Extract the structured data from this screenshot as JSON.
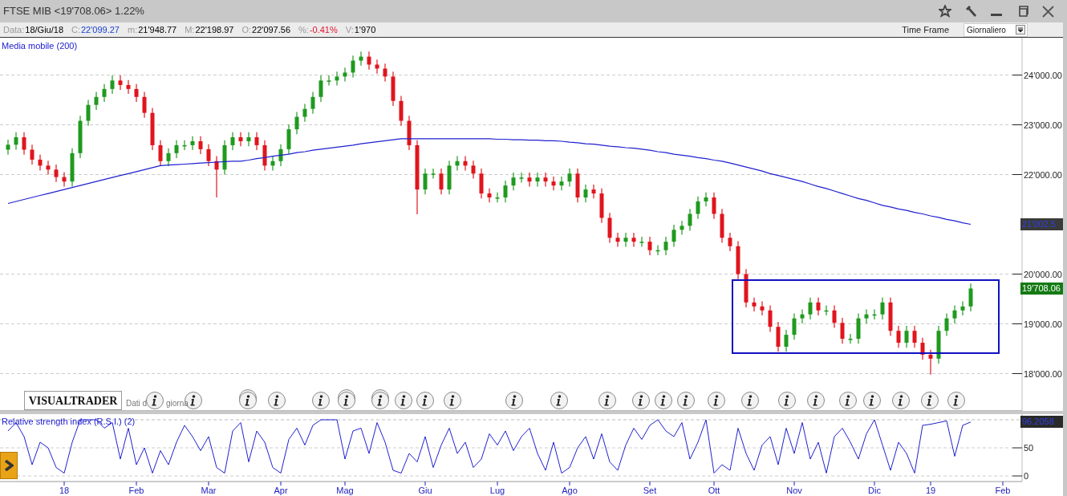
{
  "window": {
    "title": "FTSE MIB <19'708.06> 1.22%"
  },
  "info_bar": [
    {
      "label": "Data:",
      "value": "18/Giu/18"
    },
    {
      "label": "C:",
      "value": "22'099.27",
      "color": "#1a3fd0"
    },
    {
      "label": "m:",
      "value": "21'948.77"
    },
    {
      "label": "M:",
      "value": "22'198.97"
    },
    {
      "label": "O:",
      "value": "22'097.56"
    },
    {
      "label": "%:",
      "value": "-0.41%",
      "color": "#e0152d"
    },
    {
      "label": "V:",
      "value": "1'970"
    }
  ],
  "time_frame": {
    "label": "Time Frame",
    "value": "Giornaliero"
  },
  "price_panel": {
    "logo": "VISUALTRADER",
    "source_note": [
      "Dati d",
      "giorna"
    ],
    "last_values": [
      {
        "text": "21'002.5",
        "kind": "average"
      },
      {
        "text": "19'708.06",
        "kind": "price"
      }
    ],
    "events": [
      {
        "double": false
      },
      {
        "double": false
      },
      {
        "double": true
      },
      {
        "double": false
      },
      {
        "double": false
      },
      {
        "double": true
      },
      {
        "double": true
      },
      {
        "double": false
      },
      {
        "double": false
      },
      {
        "double": false
      },
      {
        "double": false
      },
      {
        "double": false
      },
      {
        "double": false
      },
      {
        "double": false
      },
      {
        "double": false
      },
      {
        "double": false
      },
      {
        "double": false
      },
      {
        "double": false
      },
      {
        "double": false
      },
      {
        "double": false
      },
      {
        "double": false
      },
      {
        "double": false
      },
      {
        "double": false
      },
      {
        "double": false
      },
      {
        "double": false
      }
    ],
    "chart_data": {
      "type": "candlestick",
      "grid": true,
      "ylim": [
        17250,
        24750
      ],
      "categories": [
        null,
        null,
        null,
        null,
        null,
        null,
        null,
        null,
        null,
        null,
        null,
        null,
        null,
        null,
        null,
        null,
        null,
        null,
        null,
        null,
        null,
        null,
        null,
        null,
        null,
        null,
        null,
        null,
        null,
        null,
        null,
        null,
        null,
        null,
        null,
        null,
        null,
        null,
        null,
        null,
        null,
        null,
        null,
        null,
        null,
        null,
        null,
        null,
        null,
        null,
        null,
        null,
        null,
        null,
        null,
        null,
        null,
        null,
        null,
        null,
        null,
        null,
        null,
        null,
        null,
        null,
        null,
        null,
        null,
        null,
        null,
        null,
        null,
        null,
        null,
        null,
        null,
        null,
        null,
        null,
        null,
        null,
        null,
        null,
        null,
        null,
        null,
        null,
        null,
        null,
        null,
        null,
        null,
        null,
        null,
        null,
        null,
        null,
        null,
        null,
        null,
        null,
        null,
        null,
        null,
        null,
        null,
        null,
        null,
        null,
        null,
        null,
        null,
        null,
        null,
        null,
        null,
        null,
        null,
        null,
        null,
        null,
        null,
        null,
        null,
        null
      ],
      "yticks": [
        {
          "value": 24000,
          "label": "24'000.00"
        },
        {
          "value": 23000,
          "label": "23'000.00"
        },
        {
          "value": 22000,
          "label": "22'000.00"
        },
        {
          "value": 20000,
          "label": "20'000.00"
        },
        {
          "value": 19000,
          "label": "19'000.00"
        },
        {
          "value": 18000,
          "label": "18'000.00"
        }
      ],
      "ohlc": [
        [
          22500,
          22700,
          22400,
          22600
        ],
        [
          22600,
          22850,
          22500,
          22750
        ],
        [
          22750,
          22850,
          22400,
          22500
        ],
        [
          22500,
          22600,
          22200,
          22300
        ],
        [
          22300,
          22400,
          22080,
          22180
        ],
        [
          22180,
          22280,
          22000,
          22100
        ],
        [
          22100,
          22200,
          21850,
          21950
        ],
        [
          21950,
          22050,
          21760,
          21860
        ],
        [
          21860,
          22530,
          21760,
          22430
        ],
        [
          22430,
          23180,
          22330,
          23080
        ],
        [
          23080,
          23500,
          22980,
          23400
        ],
        [
          23400,
          23660,
          23300,
          23560
        ],
        [
          23560,
          23820,
          23460,
          23720
        ],
        [
          23720,
          23990,
          23620,
          23890
        ],
        [
          23890,
          23990,
          23700,
          23800
        ],
        [
          23800,
          23900,
          23620,
          23720
        ],
        [
          23720,
          23820,
          23460,
          23560
        ],
        [
          23560,
          23660,
          23140,
          23240
        ],
        [
          23240,
          23340,
          22490,
          22590
        ],
        [
          22590,
          22690,
          22170,
          22270
        ],
        [
          22270,
          22530,
          22170,
          22430
        ],
        [
          22430,
          22690,
          22330,
          22590
        ],
        [
          22590,
          22690,
          22490,
          22590
        ],
        [
          22590,
          22770,
          22490,
          22670
        ],
        [
          22670,
          22770,
          22410,
          22510
        ],
        [
          22510,
          22610,
          22170,
          22270
        ],
        [
          22270,
          22370,
          21540,
          22100
        ],
        [
          22100,
          22690,
          22000,
          22590
        ],
        [
          22590,
          22850,
          22490,
          22750
        ],
        [
          22750,
          22850,
          22570,
          22670
        ],
        [
          22670,
          22850,
          22570,
          22750
        ],
        [
          22750,
          22850,
          22490,
          22590
        ],
        [
          22590,
          22690,
          22080,
          22180
        ],
        [
          22180,
          22370,
          22080,
          22270
        ],
        [
          22270,
          22610,
          22170,
          22510
        ],
        [
          22510,
          23010,
          22410,
          22910
        ],
        [
          22910,
          23260,
          22810,
          23160
        ],
        [
          23160,
          23420,
          23060,
          23320
        ],
        [
          23320,
          23660,
          23220,
          23560
        ],
        [
          23560,
          23990,
          23460,
          23890
        ],
        [
          23890,
          23990,
          23790,
          23890
        ],
        [
          23890,
          24070,
          23790,
          23970
        ],
        [
          23970,
          24150,
          23870,
          24050
        ],
        [
          24050,
          24390,
          23950,
          24290
        ],
        [
          24290,
          24470,
          24190,
          24370
        ],
        [
          24370,
          24470,
          24110,
          24210
        ],
        [
          24210,
          24310,
          24030,
          24130
        ],
        [
          24130,
          24230,
          23870,
          23970
        ],
        [
          23970,
          24070,
          23380,
          23480
        ],
        [
          23480,
          23580,
          22980,
          23080
        ],
        [
          23080,
          23180,
          22490,
          22590
        ],
        [
          22590,
          22690,
          21200,
          21700
        ],
        [
          21700,
          22120,
          21600,
          22020
        ],
        [
          22020,
          22120,
          21920,
          22020
        ],
        [
          22020,
          22120,
          21600,
          21700
        ],
        [
          21700,
          22280,
          21600,
          22180
        ],
        [
          22180,
          22370,
          22080,
          22270
        ],
        [
          22270,
          22370,
          22080,
          22180
        ],
        [
          22180,
          22280,
          21920,
          22020
        ],
        [
          22020,
          22120,
          21520,
          21620
        ],
        [
          21620,
          21720,
          21440,
          21540
        ],
        [
          21540,
          21640,
          21440,
          21540
        ],
        [
          21540,
          21880,
          21440,
          21780
        ],
        [
          21780,
          22040,
          21680,
          21940
        ],
        [
          21940,
          22040,
          21840,
          21940
        ],
        [
          21940,
          22040,
          21760,
          21860
        ],
        [
          21860,
          22040,
          21760,
          21940
        ],
        [
          21940,
          22040,
          21760,
          21860
        ],
        [
          21860,
          21960,
          21680,
          21780
        ],
        [
          21780,
          21960,
          21680,
          21860
        ],
        [
          21860,
          22120,
          21760,
          22020
        ],
        [
          22020,
          22120,
          21440,
          21540
        ],
        [
          21540,
          21800,
          21440,
          21700
        ],
        [
          21700,
          21800,
          21520,
          21620
        ],
        [
          21620,
          21720,
          21030,
          21130
        ],
        [
          21130,
          21230,
          20630,
          20730
        ],
        [
          20730,
          20830,
          20550,
          20650
        ],
        [
          20650,
          20830,
          20550,
          20730
        ],
        [
          20730,
          20830,
          20550,
          20650
        ],
        [
          20650,
          20750,
          20550,
          20650
        ],
        [
          20650,
          20750,
          20380,
          20480
        ],
        [
          20480,
          20580,
          20380,
          20480
        ],
        [
          20480,
          20750,
          20380,
          20650
        ],
        [
          20650,
          20990,
          20550,
          20890
        ],
        [
          20890,
          21070,
          20790,
          20970
        ],
        [
          20970,
          21310,
          20870,
          21210
        ],
        [
          21210,
          21560,
          21110,
          21460
        ],
        [
          21460,
          21640,
          21360,
          21540
        ],
        [
          21540,
          21640,
          21110,
          21210
        ],
        [
          21210,
          21310,
          20630,
          20730
        ],
        [
          20730,
          20830,
          20460,
          20560
        ],
        [
          20560,
          20660,
          19900,
          20000
        ],
        [
          20000,
          20100,
          19330,
          19430
        ],
        [
          19430,
          19530,
          19250,
          19350
        ],
        [
          19350,
          19450,
          19170,
          19270
        ],
        [
          19270,
          19370,
          18840,
          18940
        ],
        [
          18940,
          19040,
          18440,
          18540
        ],
        [
          18540,
          18880,
          18440,
          18780
        ],
        [
          18780,
          19210,
          18680,
          19110
        ],
        [
          19110,
          19290,
          19010,
          19190
        ],
        [
          19190,
          19530,
          19090,
          19430
        ],
        [
          19430,
          19530,
          19170,
          19270
        ],
        [
          19270,
          19370,
          19170,
          19270
        ],
        [
          19270,
          19370,
          18920,
          19020
        ],
        [
          19020,
          19120,
          18600,
          18700
        ],
        [
          18700,
          18800,
          18600,
          18700
        ],
        [
          18700,
          19210,
          18600,
          19110
        ],
        [
          19110,
          19290,
          19010,
          19190
        ],
        [
          19190,
          19290,
          19090,
          19190
        ],
        [
          19190,
          19530,
          19090,
          19430
        ],
        [
          19430,
          19530,
          18760,
          18860
        ],
        [
          18860,
          18960,
          18520,
          18620
        ],
        [
          18620,
          18960,
          18520,
          18860
        ],
        [
          18860,
          18960,
          18520,
          18620
        ],
        [
          18620,
          18720,
          18280,
          18380
        ],
        [
          18380,
          18480,
          17980,
          18300
        ],
        [
          18300,
          18960,
          18200,
          18860
        ],
        [
          18860,
          19210,
          18760,
          19110
        ],
        [
          19110,
          19370,
          19010,
          19270
        ],
        [
          19270,
          19450,
          19170,
          19350
        ],
        [
          19350,
          19810,
          19250,
          19710
        ],
        null,
        null,
        null,
        null,
        null
      ],
      "series": [
        {
          "name": "Media mobile (200)",
          "type": "line",
          "color": "#2020d0",
          "values": [
            21420,
            21460,
            21500,
            21540,
            21580,
            21620,
            21660,
            21700,
            21740,
            21780,
            21820,
            21860,
            21900,
            21940,
            21980,
            22020,
            22060,
            22100,
            22140,
            22180,
            22190,
            22200,
            22210,
            22220,
            22230,
            22240,
            22250,
            22260,
            22270,
            22270,
            22290,
            22320,
            22340,
            22370,
            22390,
            22410,
            22440,
            22460,
            22490,
            22510,
            22530,
            22550,
            22570,
            22590,
            22620,
            22640,
            22660,
            22680,
            22700,
            22720,
            22720,
            22720,
            22720,
            22720,
            22720,
            22720,
            22720,
            22720,
            22720,
            22720,
            22720,
            22710,
            22710,
            22700,
            22700,
            22690,
            22690,
            22680,
            22680,
            22670,
            22650,
            22640,
            22620,
            22610,
            22590,
            22570,
            22560,
            22540,
            22530,
            22510,
            22490,
            22460,
            22440,
            22410,
            22390,
            22370,
            22340,
            22320,
            22290,
            22270,
            22230,
            22190,
            22150,
            22110,
            22070,
            22020,
            21980,
            21940,
            21900,
            21860,
            21810,
            21760,
            21720,
            21670,
            21620,
            21570,
            21520,
            21480,
            21430,
            21380,
            21350,
            21310,
            21280,
            21240,
            21210,
            21170,
            21140,
            21100,
            21070,
            21030,
            21000,
            null,
            null,
            null,
            null,
            null
          ]
        }
      ]
    }
  },
  "rsi_panel": {
    "last_value": "96.2058",
    "chart_data": {
      "type": "line",
      "grid": true,
      "ylim": [
        -10,
        100
      ],
      "categories": [
        null,
        null,
        null,
        null,
        null,
        null,
        null,
        "18",
        null,
        null,
        null,
        null,
        null,
        null,
        null,
        null,
        "Feb",
        null,
        null,
        null,
        null,
        null,
        null,
        null,
        null,
        "Mar",
        null,
        null,
        null,
        null,
        null,
        null,
        null,
        null,
        "Apr",
        null,
        null,
        null,
        null,
        null,
        null,
        null,
        "Mag",
        null,
        null,
        null,
        null,
        null,
        null,
        null,
        null,
        null,
        "Giu",
        null,
        null,
        null,
        null,
        null,
        null,
        null,
        null,
        "Lug",
        null,
        null,
        null,
        null,
        null,
        null,
        null,
        null,
        "Ago",
        null,
        null,
        null,
        null,
        null,
        null,
        null,
        null,
        null,
        "Set",
        null,
        null,
        null,
        null,
        null,
        null,
        null,
        "Ott",
        null,
        null,
        null,
        null,
        null,
        null,
        null,
        null,
        null,
        "Nov",
        null,
        null,
        null,
        null,
        null,
        null,
        null,
        null,
        null,
        "Dic",
        null,
        null,
        null,
        null,
        null,
        null,
        "19",
        null,
        null,
        null,
        null,
        null,
        null,
        null,
        null,
        "Feb",
        null
      ],
      "yticks": [
        {
          "value": 50,
          "label": "50"
        },
        {
          "value": 0,
          "label": "0"
        }
      ],
      "series": [
        {
          "name": "Relative strength index (R.S.I.) (2)",
          "color": "#2020d0",
          "values": [
            80,
            95,
            70,
            20,
            60,
            50,
            15,
            5,
            60,
            100,
            100,
            100,
            85,
            95,
            30,
            85,
            20,
            50,
            5,
            45,
            20,
            60,
            90,
            70,
            45,
            70,
            15,
            5,
            80,
            95,
            25,
            80,
            60,
            15,
            5,
            65,
            85,
            55,
            90,
            100,
            100,
            100,
            30,
            80,
            85,
            40,
            95,
            60,
            10,
            5,
            40,
            25,
            70,
            15,
            55,
            85,
            40,
            60,
            15,
            30,
            75,
            55,
            80,
            45,
            70,
            85,
            40,
            10,
            60,
            5,
            15,
            50,
            70,
            30,
            75,
            25,
            10,
            55,
            85,
            65,
            90,
            100,
            80,
            70,
            95,
            30,
            60,
            100,
            5,
            20,
            10,
            85,
            40,
            10,
            55,
            70,
            20,
            85,
            40,
            95,
            30,
            60,
            5,
            70,
            85,
            60,
            30,
            75,
            100,
            55,
            10,
            60,
            40,
            5,
            90,
            92,
            95,
            98,
            35,
            90,
            96,
            null,
            null,
            null,
            null,
            null
          ]
        }
      ]
    }
  }
}
